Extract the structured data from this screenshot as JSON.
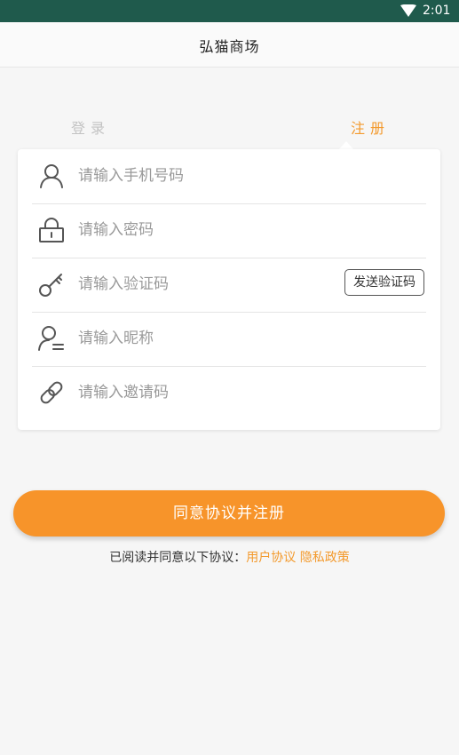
{
  "status_bar": {
    "time": "2:01",
    "icons": [
      "wifi-icon"
    ]
  },
  "header": {
    "title": "弘猫商场"
  },
  "tabs": {
    "login": "登录",
    "register": "注册",
    "active": "register"
  },
  "form": {
    "phone": {
      "placeholder": "请输入手机号码",
      "value": "",
      "icon": "user-icon"
    },
    "password": {
      "placeholder": "请输入密码",
      "value": "",
      "icon": "lock-icon"
    },
    "code": {
      "placeholder": "请输入验证码",
      "value": "",
      "icon": "key-icon",
      "send_button": "发送验证码"
    },
    "nickname": {
      "placeholder": "请输入昵称",
      "value": "",
      "icon": "user-edit-icon"
    },
    "invite": {
      "placeholder": "请输入邀请码",
      "value": "",
      "icon": "link-icon"
    }
  },
  "submit": {
    "label": "同意协议并注册"
  },
  "agreement": {
    "prefix": "已阅读并同意以下协议：",
    "user_agreement": "用户协议",
    "privacy_policy": "隐私政策"
  },
  "colors": {
    "status_bar": "#1f5a4c",
    "accent": "#f7942a",
    "accent_text": "#f39a2d",
    "tab_inactive": "#c3c3c3",
    "background": "#f6f6f6"
  }
}
